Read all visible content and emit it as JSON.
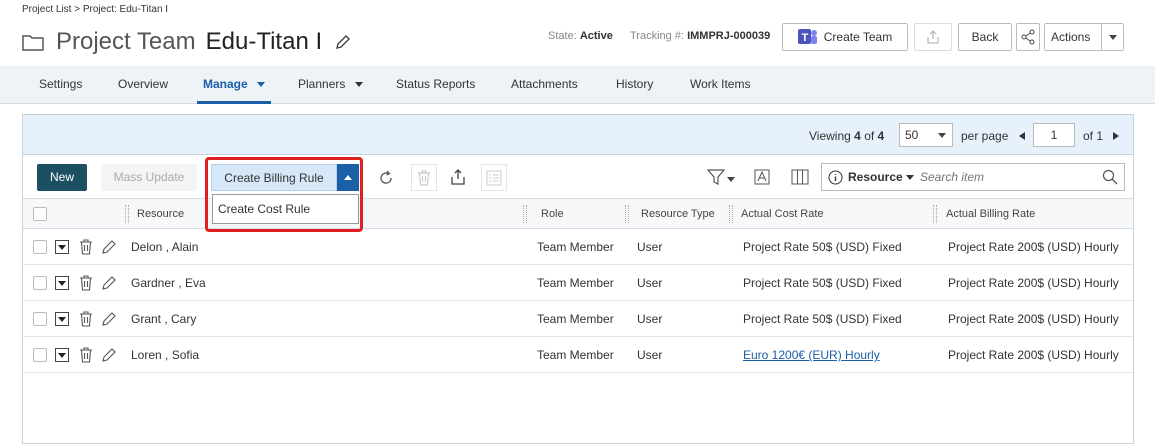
{
  "breadcrumb": "Project List > Project: Edu-Titan I",
  "header": {
    "kind": "Project Team",
    "name": "Edu-Titan I",
    "state_label": "State:",
    "state_value": "Active",
    "tracking_label": "Tracking #:",
    "tracking_value": "IMMPRJ-000039",
    "create_team": "Create Team",
    "back": "Back",
    "actions": "Actions"
  },
  "tabs": [
    "Settings",
    "Overview",
    "Manage",
    "Planners",
    "Status Reports",
    "Attachments",
    "History",
    "Work Items"
  ],
  "pager": {
    "viewing_label": "Viewing",
    "viewing_count": "4",
    "of_label": "of",
    "total": "4",
    "per_page_value": "50",
    "per_page_label": "per page",
    "page_value": "1",
    "of_pages": "of 1"
  },
  "toolbar": {
    "new": "New",
    "mass_update": "Mass Update",
    "create_billing_rule": "Create Billing Rule",
    "create_cost_rule": "Create Cost Rule",
    "search_field": "Resource",
    "search_placeholder": "Search item"
  },
  "columns": [
    "Resource",
    "Role",
    "Resource Type",
    "Actual Cost Rate",
    "Actual Billing Rate"
  ],
  "rows": [
    {
      "resource": "Delon , Alain",
      "role": "Team Member",
      "type": "User",
      "cost": "Project Rate 50$ (USD) Fixed",
      "billing": "Project Rate 200$ (USD) Hourly"
    },
    {
      "resource": "Gardner , Eva",
      "role": "Team Member",
      "type": "User",
      "cost": "Project Rate 50$ (USD) Fixed",
      "billing": "Project Rate 200$ (USD) Hourly"
    },
    {
      "resource": "Grant , Cary",
      "role": "Team Member",
      "type": "User",
      "cost": "Project Rate 50$ (USD) Fixed",
      "billing": "Project Rate 200$ (USD) Hourly"
    },
    {
      "resource": "Loren , Sofia",
      "role": "Team Member",
      "type": "User",
      "cost": "Euro 1200€ (EUR) Hourly",
      "billing": "Project Rate 200$ (USD) Hourly"
    }
  ],
  "colors": {
    "accent": "#1b5fa8",
    "highlight": "#e02020",
    "new_button": "#1d4f63"
  }
}
